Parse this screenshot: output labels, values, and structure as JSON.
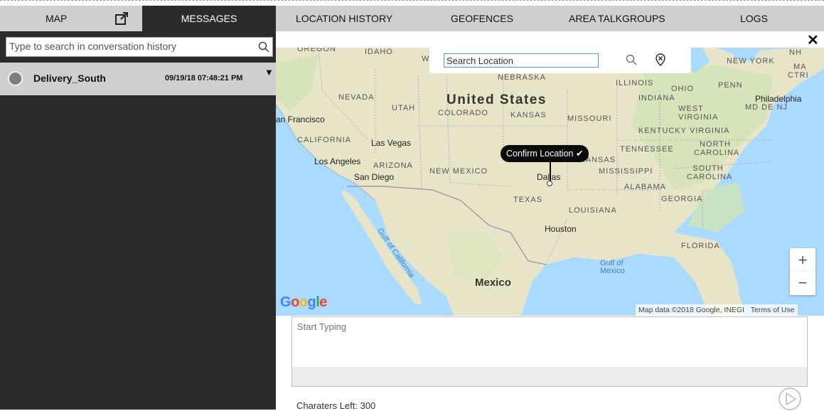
{
  "left_panel": {
    "tab_map": "MAP",
    "tab_messages": "MESSAGES",
    "search_placeholder": "Type to search in conversation history",
    "conversation": {
      "name": "Delivery_South",
      "timestamp": "09/19/18 07:48:21 PM"
    }
  },
  "top_tabs": [
    "LOCATION HISTORY",
    "GEOFENCES",
    "AREA TALKGROUPS",
    "LOGS"
  ],
  "map": {
    "search_value": "Search Location",
    "confirm_label": "Confirm Location",
    "zoom_in": "+",
    "zoom_out": "−",
    "logo": "Google",
    "attribution": "Map data ©2018 Google, INEGI",
    "terms": "Terms of Use",
    "labels": {
      "oregon": "OREGON",
      "idaho": "IDAHO",
      "w": "W",
      "nebraska": "NEBRASKA",
      "nevada": "NEVADA",
      "utah": "UTAH",
      "united_states": "United States",
      "colorado": "COLORADO",
      "kansas": "KANSAS",
      "missouri": "MISSOURI",
      "illinois": "ILLINOIS",
      "indiana": "INDIANA",
      "ohio": "OHIO",
      "penn": "PENN",
      "new_york": "NEW YORK",
      "nh": "NH",
      "ma": "MA",
      "ctri": "CTRI",
      "philadelphia": "Philadelphia",
      "mdnj": "MD DE NJ",
      "west_virginia": "WEST VIRGINIA",
      "kentucky": "KENTUCKY",
      "virginia": "VIRGINIA",
      "san_francisco": "an Francisco",
      "california": "CALIFORNIA",
      "las_vegas": "Las Vegas",
      "tennessee": "TENNESSEE",
      "north_carolina": "NORTH CAROLINA",
      "los_angeles": "Los Angeles",
      "arizona": "ARIZONA",
      "san_diego": "San Diego",
      "new_mexico": "NEW MEXICO",
      "arkansas": "ARKANSAS",
      "dallas": "Dallas",
      "mississippi": "MISSISSIPPI",
      "south_carolina": "SOUTH CAROLINA",
      "alabama": "ALABAMA",
      "georgia": "GEORGIA",
      "texas": "TEXAS",
      "louisiana": "LOUISIANA",
      "houston": "Houston",
      "gulf_of_california": "Gulf of California",
      "florida": "FLORIDA",
      "gulf_of_mexico": "Gulf of Mexico",
      "mexico": "Mexico"
    }
  },
  "compose": {
    "placeholder": "Start Typing",
    "chars_left": "Charaters Left: 300"
  },
  "colors": {
    "dark_panel": "#2b2b2b",
    "tab_bg": "#cfcfcf",
    "water": "#aadaff",
    "land": "#e9e3c9"
  }
}
